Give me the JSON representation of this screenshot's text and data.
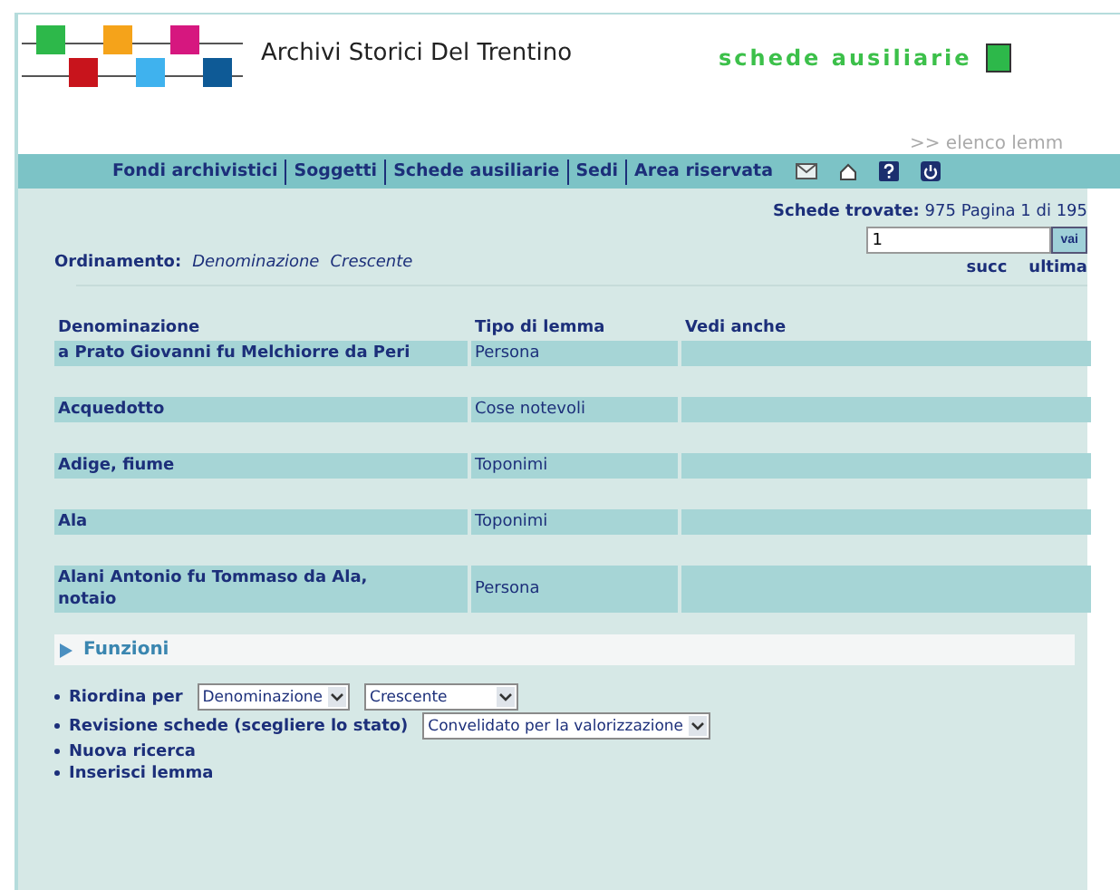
{
  "header": {
    "title": "Archivi Storici Del Trentino",
    "section": "schede ausiliarie",
    "breadcrumb": ">> elenco lemm"
  },
  "nav": {
    "items": [
      "Fondi archivistici",
      "Soggetti",
      "Schede ausiliarie",
      "Sedi",
      "Area riservata"
    ]
  },
  "results": {
    "label": "Schede trovate:",
    "summary": "975 Pagina 1 di 195",
    "page_value": "1",
    "go_button": "vai",
    "links": [
      "succ",
      "ultima"
    ]
  },
  "ordering": {
    "label": "Ordinamento:",
    "field": "Denominazione",
    "direction": "Crescente"
  },
  "table": {
    "columns": [
      "Denominazione",
      "Tipo di lemma",
      "Vedi anche"
    ],
    "rows": [
      {
        "name": "a Prato Giovanni fu Melchiorre da Peri",
        "type": "Persona"
      },
      {
        "name": "Acquedotto",
        "type": "Cose notevoli"
      },
      {
        "name": "Adige, fiume",
        "type": "Toponimi"
      },
      {
        "name": "Ala",
        "type": "Toponimi"
      },
      {
        "name": "Alani Antonio fu Tommaso da Ala, notaio",
        "type": "Persona"
      }
    ]
  },
  "functions": {
    "title": "Funzioni",
    "items": [
      {
        "label": "Riordina per",
        "selects": [
          "Denominazione",
          "Crescente"
        ]
      },
      {
        "label": "Revisione schede (scegliere lo stato)",
        "selects": [
          "Convelidato per la valorizzazione"
        ]
      },
      {
        "label": "Nuova ricerca"
      },
      {
        "label": "Inserisci lemma"
      }
    ]
  }
}
